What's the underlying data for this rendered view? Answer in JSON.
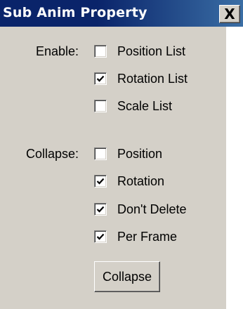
{
  "window": {
    "title": "Sub Anim Property",
    "close_label": "X"
  },
  "enable": {
    "label": "Enable:",
    "items": [
      {
        "label": "Position List",
        "checked": false
      },
      {
        "label": "Rotation List",
        "checked": true
      },
      {
        "label": "Scale List",
        "checked": false
      }
    ]
  },
  "collapse": {
    "label": "Collapse:",
    "items": [
      {
        "label": "Position",
        "checked": false
      },
      {
        "label": "Rotation",
        "checked": true
      },
      {
        "label": "Don't Delete",
        "checked": true
      },
      {
        "label": "Per Frame",
        "checked": true
      }
    ],
    "button_label": "Collapse"
  },
  "colors": {
    "title_bar": "#0a246a",
    "face": "#d4d0c8"
  }
}
